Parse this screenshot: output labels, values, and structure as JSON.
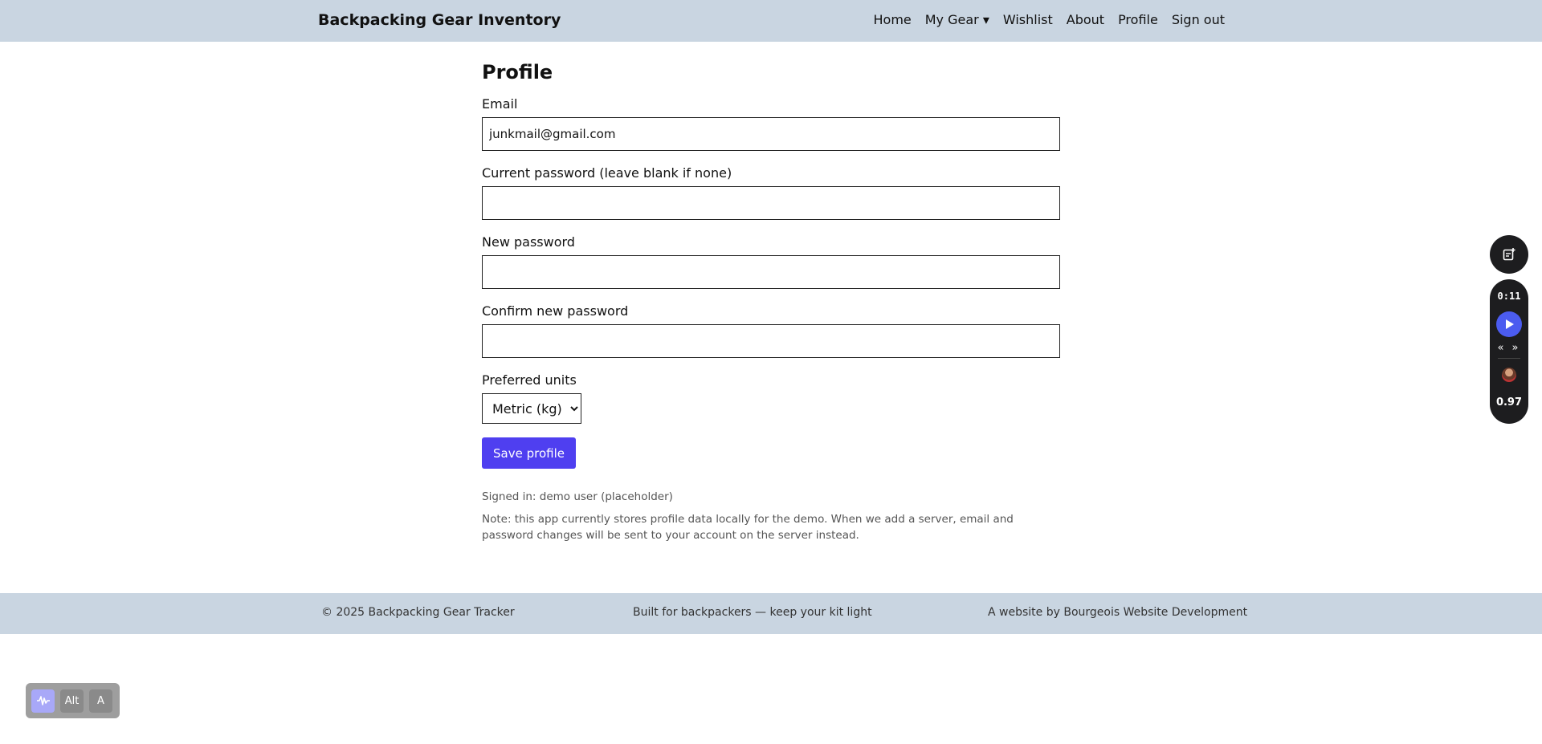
{
  "header": {
    "brand": "Backpacking Gear Inventory",
    "nav": [
      "Home",
      "My Gear ▾",
      "Wishlist",
      "About",
      "Profile",
      "Sign out"
    ]
  },
  "main": {
    "title": "Profile",
    "email_label": "Email",
    "email_value": "junkmail@gmail.com",
    "current_password_label": "Current password (leave blank if none)",
    "new_password_label": "New password",
    "confirm_password_label": "Confirm new password",
    "units_label": "Preferred units",
    "units_selected": "Metric (kg)",
    "save_label": "Save profile",
    "signed_in_text": "Signed in: demo user (placeholder)",
    "note_text": "Note: this app currently stores profile data locally for the demo. When we add a server, email and password changes will be sent to your account on the server instead."
  },
  "footer": {
    "copyright": "© 2025 Backpacking Gear Tracker",
    "tagline": "Built for backpackers — keep your kit light",
    "credit": "A website by Bourgeois Website Development"
  },
  "player": {
    "time": "0:11",
    "skip": "« »",
    "speed": "0.97",
    "top_icon": "note-add-icon",
    "play_icon": "play-icon"
  },
  "a11y_toolbar": {
    "wave_icon": "waveform-icon",
    "alt_label": "Alt",
    "a_label": "A"
  },
  "colors": {
    "header_bg": "#c9d5e1",
    "accent": "#4f3ff0",
    "player_bg": "#1d1d1f",
    "play_button": "#4b5cf0"
  }
}
